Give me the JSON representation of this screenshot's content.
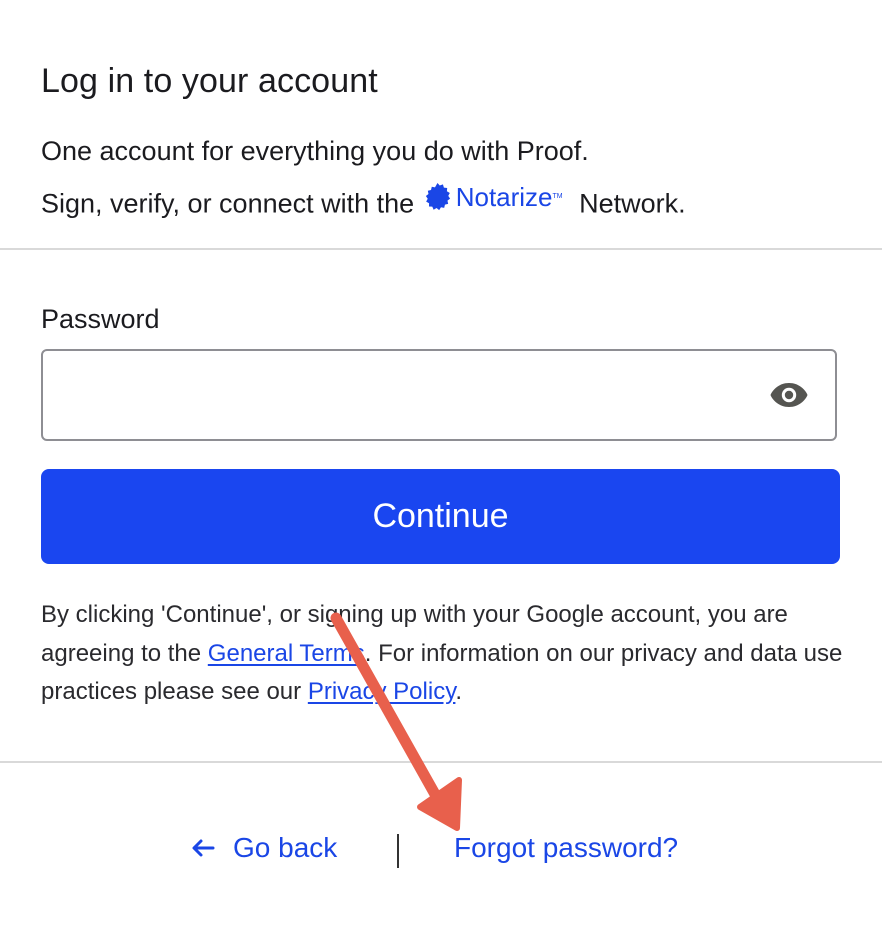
{
  "header": {
    "title": "Log in to your account",
    "line1": "One account for everything you do with Proof.",
    "line2_prefix": "Sign, verify, or connect with the",
    "brand_name": "Notarize",
    "brand_tm": "TM",
    "line2_suffix": "Network."
  },
  "form": {
    "password_label": "Password",
    "password_value": "",
    "password_placeholder": "",
    "continue_label": "Continue"
  },
  "legal": {
    "part1": "By clicking 'Continue', or signing up with your Google account, you are agreeing to the",
    "terms_link": "General Terms",
    "part2": ". For information on our privacy and data use practices please see our",
    "privacy_link": "Privacy Policy",
    "part3": "."
  },
  "footer": {
    "go_back_label": "Go back",
    "forgot_label": "Forgot password?"
  },
  "colors": {
    "accent": "#1a46f0",
    "link": "#1a46e6",
    "annotation_arrow": "#e8604c",
    "divider": "#d9d9d9"
  },
  "icons": {
    "brand": "notarize-seal-icon",
    "password_toggle": "eye-icon",
    "back": "arrow-left-icon",
    "annotation": "red-arrow-annotation"
  }
}
